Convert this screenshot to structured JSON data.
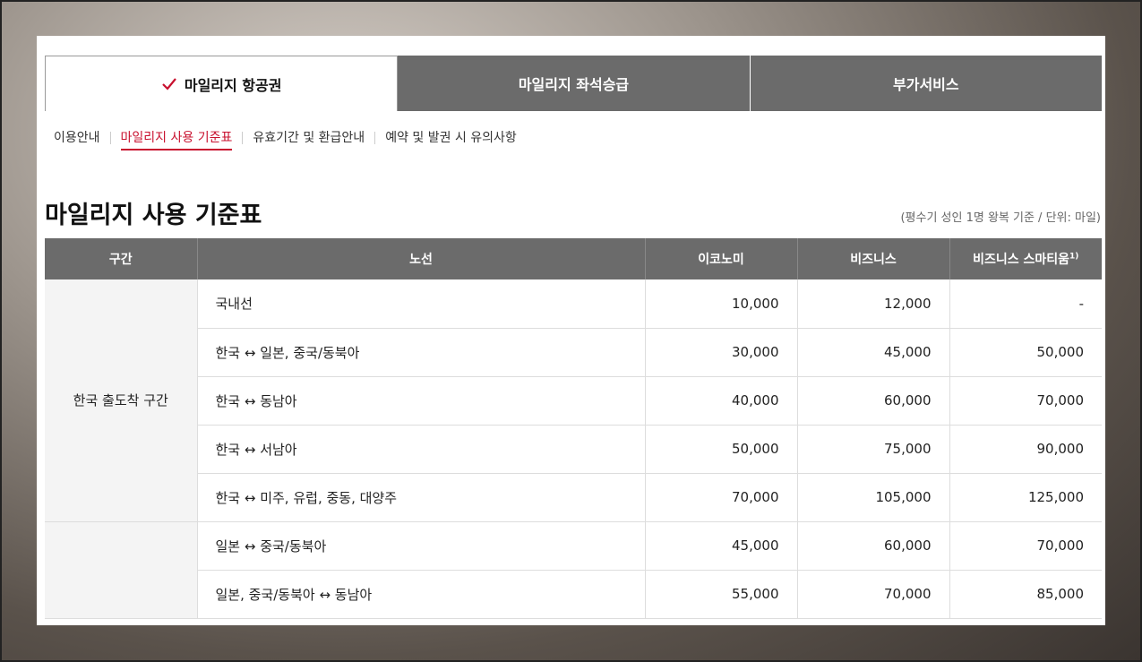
{
  "tabs": [
    {
      "label": "마일리지 항공권",
      "active": true
    },
    {
      "label": "마일리지 좌석승급",
      "active": false
    },
    {
      "label": "부가서비스",
      "active": false
    }
  ],
  "subnav": [
    {
      "label": "이용안내",
      "active": false
    },
    {
      "label": "마일리지 사용 기준표",
      "active": true
    },
    {
      "label": "유효기간 및 환급안내",
      "active": false
    },
    {
      "label": "예약 및 발권 시 유의사항",
      "active": false
    }
  ],
  "page_title": "마일리지 사용 기준표",
  "unit_note": "(평수기 성인 1명 왕복 기준 / 단위: 마일)",
  "table": {
    "headers": {
      "region": "구간",
      "route": "노선",
      "economy": "이코노미",
      "business": "비즈니스",
      "smartium": "비즈니스 스마티움",
      "smartium_note": "1)"
    },
    "groups": [
      {
        "region": "한국 출도착 구간",
        "rows": [
          {
            "route": "국내선",
            "economy": "10,000",
            "business": "12,000",
            "smartium": "-"
          },
          {
            "route": "한국 ↔ 일본, 중국/동북아",
            "economy": "30,000",
            "business": "45,000",
            "smartium": "50,000"
          },
          {
            "route": "한국 ↔ 동남아",
            "economy": "40,000",
            "business": "60,000",
            "smartium": "70,000"
          },
          {
            "route": "한국 ↔ 서남아",
            "economy": "50,000",
            "business": "75,000",
            "smartium": "90,000"
          },
          {
            "route": "한국 ↔ 미주, 유럽, 중동, 대양주",
            "economy": "70,000",
            "business": "105,000",
            "smartium": "125,000"
          }
        ]
      },
      {
        "region": "",
        "rows": [
          {
            "route": "일본 ↔ 중국/동북아",
            "economy": "45,000",
            "business": "60,000",
            "smartium": "70,000"
          },
          {
            "route": "일본, 중국/동북아 ↔ 동남아",
            "economy": "55,000",
            "business": "70,000",
            "smartium": "85,000"
          }
        ]
      }
    ]
  },
  "colors": {
    "accent": "#c8102e",
    "header_bg": "#6b6b6b"
  }
}
